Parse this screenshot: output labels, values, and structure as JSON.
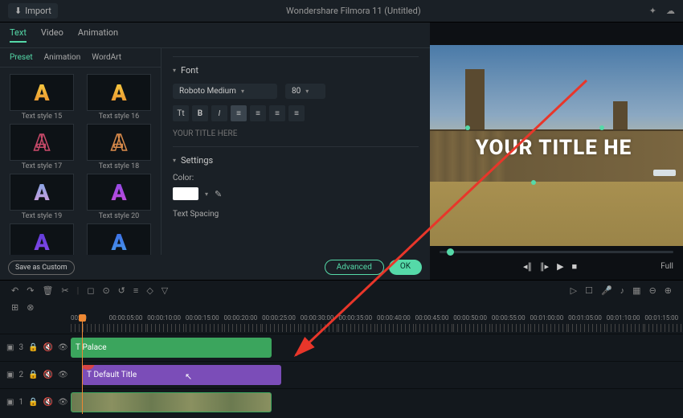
{
  "header": {
    "import": "Import",
    "title": "Wondershare Filmora 11 (Untitled)"
  },
  "tabs": {
    "text": "Text",
    "video": "Video",
    "animation": "Animation"
  },
  "subtabs": {
    "preset": "Preset",
    "animation": "Animation",
    "wordart": "WordArt"
  },
  "presets": [
    {
      "label": "Text style 15",
      "fill": "linear-gradient(180deg,#f9d342,#e88b2e)",
      "stroke": null
    },
    {
      "label": "Text style 16",
      "fill": "linear-gradient(180deg,#f9d342,#e88b2e)",
      "stroke": null
    },
    {
      "label": "Text style 17",
      "fill": "transparent",
      "stroke": "#c94a6a"
    },
    {
      "label": "Text style 18",
      "fill": "transparent",
      "stroke": "#d88a4a"
    },
    {
      "label": "Text style 19",
      "fill": "linear-gradient(180deg,#7aa8e8,#d89ad8)",
      "stroke": null
    },
    {
      "label": "Text style 20",
      "fill": "linear-gradient(180deg,#8a4ae8,#c94ad8)",
      "stroke": null
    },
    {
      "label": "",
      "fill": "linear-gradient(180deg,#5a3ad8,#8a4ae8)",
      "stroke": null
    },
    {
      "label": "",
      "fill": "linear-gradient(180deg,#3a6ae8,#4a9ae8)",
      "stroke": null
    }
  ],
  "font": {
    "section": "Font",
    "family": "Roboto Medium",
    "size": "80",
    "placeholder": "YOUR TITLE HERE"
  },
  "settings": {
    "section": "Settings",
    "color_label": "Color:",
    "spacing_label": "Text Spacing"
  },
  "buttons": {
    "save_custom": "Save as Custom",
    "advanced": "Advanced",
    "ok": "OK"
  },
  "preview": {
    "title_text": "YOUR TITLE HE",
    "full": "Full"
  },
  "ruler": [
    "00:00",
    "00:00:05:00",
    "00:00:10:00",
    "00:00:15:00",
    "00:00:20:00",
    "00:00:25:00",
    "00:00:30:00",
    "00:00:35:00",
    "00:00:40:00",
    "00:00:45:00",
    "00:00:50:00",
    "00:00:55:00",
    "00:01:00:00",
    "00:01:05:00",
    "00:01:10:00",
    "00:01:15:00"
  ],
  "tracks": {
    "t3": "3",
    "t2": "2",
    "t1": "1",
    "clip_palace": "Palace",
    "clip_title": "Default Title"
  }
}
